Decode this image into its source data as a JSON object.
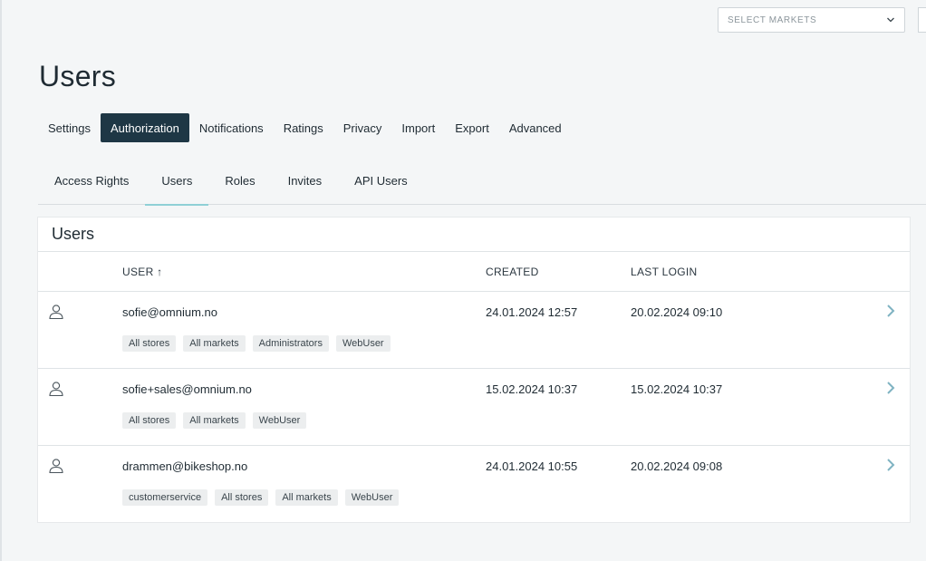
{
  "header": {
    "market_select_placeholder": "SELECT MARKETS",
    "page_title": "Users"
  },
  "main_tabs": [
    {
      "label": "Settings",
      "active": false
    },
    {
      "label": "Authorization",
      "active": true
    },
    {
      "label": "Notifications",
      "active": false
    },
    {
      "label": "Ratings",
      "active": false
    },
    {
      "label": "Privacy",
      "active": false
    },
    {
      "label": "Import",
      "active": false
    },
    {
      "label": "Export",
      "active": false
    },
    {
      "label": "Advanced",
      "active": false
    }
  ],
  "sub_tabs": [
    {
      "label": "Access Rights",
      "active": false
    },
    {
      "label": "Users",
      "active": true
    },
    {
      "label": "Roles",
      "active": false
    },
    {
      "label": "Invites",
      "active": false
    },
    {
      "label": "API Users",
      "active": false
    }
  ],
  "card": {
    "title": "Users",
    "columns": {
      "user": "USER ↑",
      "created": "CREATED",
      "last_login": "LAST LOGIN"
    },
    "rows": [
      {
        "email": "sofie@omnium.no",
        "created": "24.01.2024 12:57",
        "last_login": "20.02.2024 09:10",
        "tags": [
          "All stores",
          "All markets",
          "Administrators",
          "WebUser"
        ]
      },
      {
        "email": "sofie+sales@omnium.no",
        "created": "15.02.2024 10:37",
        "last_login": "15.02.2024 10:37",
        "tags": [
          "All stores",
          "All markets",
          "WebUser"
        ]
      },
      {
        "email": "drammen@bikeshop.no",
        "created": "24.01.2024 10:55",
        "last_login": "20.02.2024 09:08",
        "tags": [
          "customerservice",
          "All stores",
          "All markets",
          "WebUser"
        ]
      }
    ]
  },
  "icons": {
    "market_select": "chevron-down-icon",
    "row_avatar": "user-icon",
    "row_action": "chevron-right-icon"
  },
  "colors": {
    "active_tab_bg": "#1e3745",
    "sub_tab_underline": "#8fd0d6",
    "chevron": "#7fb3c2"
  }
}
